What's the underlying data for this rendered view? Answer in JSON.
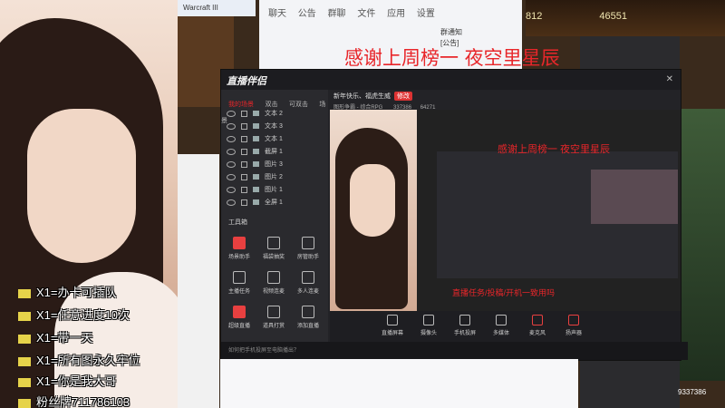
{
  "stream_overlay": {
    "commands": [
      "X1=办卡可插队",
      "X1=任意进度10次",
      "X1=带一天",
      "X1=所有图永久牢位",
      "X1=你是我大哥",
      "粉丝牌711786103"
    ],
    "thanks_banner": "感谢上周榜一 夜空里星辰",
    "game_gold": "46551",
    "game_res": "812",
    "game_hero_value": "9337386"
  },
  "chat_app": {
    "window_title": "Warcraft III",
    "tabs": [
      "聊天",
      "公告",
      "群聊",
      "文件",
      "应用",
      "设置"
    ],
    "group_notice": "群通知",
    "public_tag": "[公告]"
  },
  "streamer_app": {
    "title": "直播伴侣",
    "sidebar_tabs": [
      "我的场景",
      "双击",
      "可双击",
      "场景"
    ],
    "scene_items": [
      "文本 2",
      "文本 3",
      "文本 1",
      "截屏 1",
      "图片 3",
      "图片 2",
      "图片 1",
      "全屏 1"
    ],
    "tools_label": "工具箱",
    "tools": [
      "场景助手",
      "福袋抽奖",
      "房管助手",
      "主播任务",
      "视频连麦",
      "多人连麦",
      "超级直播",
      "道具打赏",
      "添加直播"
    ],
    "preview_header": "新年快乐、福虎生威",
    "preview_tag": "修改",
    "preview_sub": "图形争霸 - 综合RPG",
    "viewer_count": "337386",
    "fan_count": "64271",
    "bottom_buttons": [
      "直播屏幕",
      "摄像头",
      "手机投屏",
      "多媒体",
      "麦克风",
      "扬声器"
    ],
    "status_hint": "如何把手机投屏至电脑播出？",
    "nested_text": "直播任务/投稿/开机一致用吗"
  },
  "colors": {
    "accent_red": "#e8262a",
    "app_bg": "#232327"
  }
}
